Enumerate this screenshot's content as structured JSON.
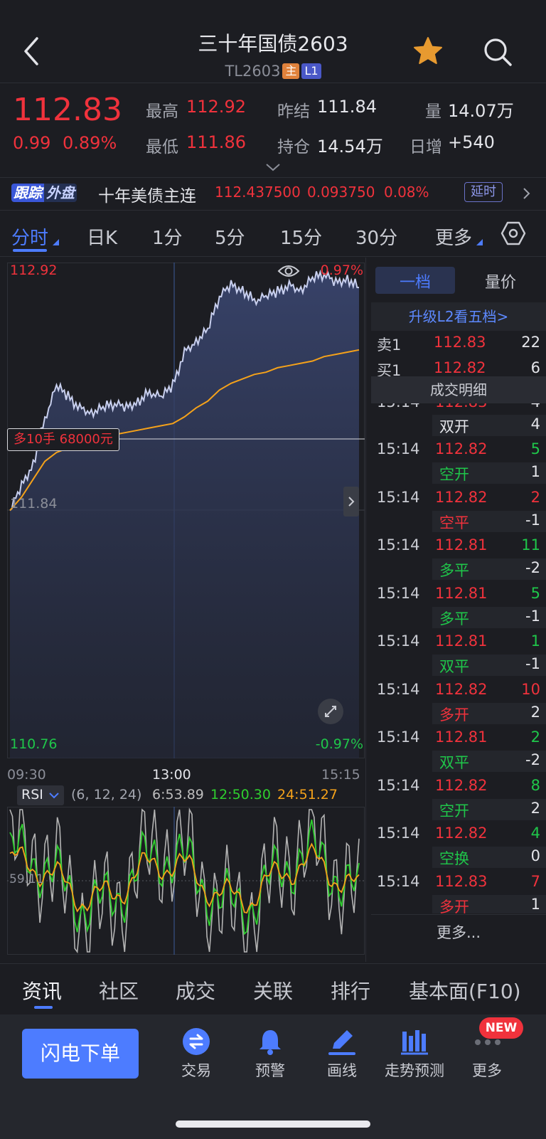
{
  "header": {
    "title": "三十年国债2603",
    "code": "TL2603",
    "tag_main": "主",
    "tag_level": "L1"
  },
  "quote": {
    "last": "112.83",
    "change": "0.99",
    "change_pct": "0.89%",
    "high_label": "最高",
    "high": "112.92",
    "low_label": "最低",
    "low": "111.86",
    "prev_settle_label": "昨结",
    "prev_settle": "111.84",
    "open_interest_label": "持仓",
    "open_interest": "14.54万",
    "volume_label": "量",
    "volume": "14.07万",
    "daily_incr_label": "日增",
    "daily_incr": "+540"
  },
  "tracker": {
    "badge_a": "跟踪",
    "badge_b": "外盘",
    "name": "十年美债主连",
    "price": "112.437500",
    "change": "0.093750",
    "change_pct": "0.08%",
    "delay": "延时"
  },
  "period_tabs": [
    "分时",
    "日K",
    "1分",
    "5分",
    "15分",
    "30分",
    "更多"
  ],
  "chart": {
    "max_label": "112.92",
    "min_label": "110.76",
    "mid_label": "111.84",
    "max_pct": "0.97%",
    "min_pct": "-0.97%",
    "times": [
      "09:30",
      "13:00",
      "15:15"
    ],
    "position_tag": "多10手 68000元",
    "indicator": "RSI",
    "indicator_params": "(6, 12, 24)",
    "rsi6": "6:53.89",
    "rsi12": "12:50.30",
    "rsi24": "24:51.27",
    "rsi_mid": "59.11",
    "colors": {
      "price": "#c8cfee",
      "avg": "#f5a21a",
      "rsi6": "#b4b4b4",
      "rsi12": "#2fcf2f",
      "rsi24": "#f5a21a"
    }
  },
  "chart_data": {
    "type": "line",
    "x_range": [
      "09:30",
      "15:15"
    ],
    "ylim": [
      110.76,
      112.92
    ],
    "series": [
      {
        "values": [
          111.84,
          111.95,
          112.05,
          112.25,
          112.4,
          112.35,
          112.3,
          112.28,
          112.3,
          112.32,
          112.3,
          112.33,
          112.37,
          112.35,
          112.4,
          112.55,
          112.6,
          112.65,
          112.8,
          112.85,
          112.83,
          112.78,
          112.8,
          112.82,
          112.85,
          112.83,
          112.88,
          112.9,
          112.86,
          112.88,
          112.84
        ]
      },
      {
        "values": [
          111.84,
          111.9,
          111.98,
          112.06,
          112.1,
          112.12,
          112.14,
          112.16,
          112.17,
          112.18,
          112.19,
          112.2,
          112.21,
          112.22,
          112.23,
          112.26,
          112.3,
          112.33,
          112.38,
          112.41,
          112.43,
          112.45,
          112.46,
          112.48,
          112.49,
          112.5,
          112.51,
          112.53,
          112.54,
          112.55,
          112.56
        ]
      }
    ]
  },
  "orderbook": {
    "tab_level1": "一档",
    "tab_volprice": "量价",
    "upgrade": "升级L2看五档>",
    "ask_label": "卖1",
    "ask_price": "112.83",
    "ask_vol": "22",
    "bid_label": "买1",
    "bid_price": "112.82",
    "bid_vol": "6",
    "trades_title": "成交明细",
    "top_partial": {
      "time": "15:14",
      "price": "112.83",
      "vol": "4"
    },
    "first_type": {
      "type": "双开",
      "delta": "4"
    },
    "trades": [
      {
        "time": "15:14",
        "price": "112.82",
        "vol": "5",
        "type": "空开",
        "delta": "1"
      },
      {
        "time": "15:14",
        "price": "112.82",
        "vol": "2",
        "type": "空平",
        "delta": "-1"
      },
      {
        "time": "15:14",
        "price": "112.81",
        "vol": "11",
        "type": "多平",
        "delta": "-2"
      },
      {
        "time": "15:14",
        "price": "112.81",
        "vol": "5",
        "type": "多平",
        "delta": "-1"
      },
      {
        "time": "15:14",
        "price": "112.81",
        "vol": "1",
        "type": "双平",
        "delta": "-1"
      },
      {
        "time": "15:14",
        "price": "112.82",
        "vol": "10",
        "type": "多开",
        "delta": "2"
      },
      {
        "time": "15:14",
        "price": "112.81",
        "vol": "2",
        "type": "双平",
        "delta": "-2"
      },
      {
        "time": "15:14",
        "price": "112.82",
        "vol": "8",
        "type": "空开",
        "delta": "2"
      },
      {
        "time": "15:14",
        "price": "112.82",
        "vol": "4",
        "type": "空换",
        "delta": "0"
      },
      {
        "time": "15:14",
        "price": "112.83",
        "vol": "7",
        "type": "多开",
        "delta": "1"
      }
    ],
    "more": "更多..."
  },
  "bottom_tabs": [
    "资讯",
    "社区",
    "成交",
    "关联",
    "排行",
    "基本面(F10)"
  ],
  "nav": {
    "flash_order": "闪电下单",
    "items": [
      "交易",
      "预警",
      "画线",
      "走势预测",
      "更多"
    ],
    "new_badge": "NEW"
  }
}
